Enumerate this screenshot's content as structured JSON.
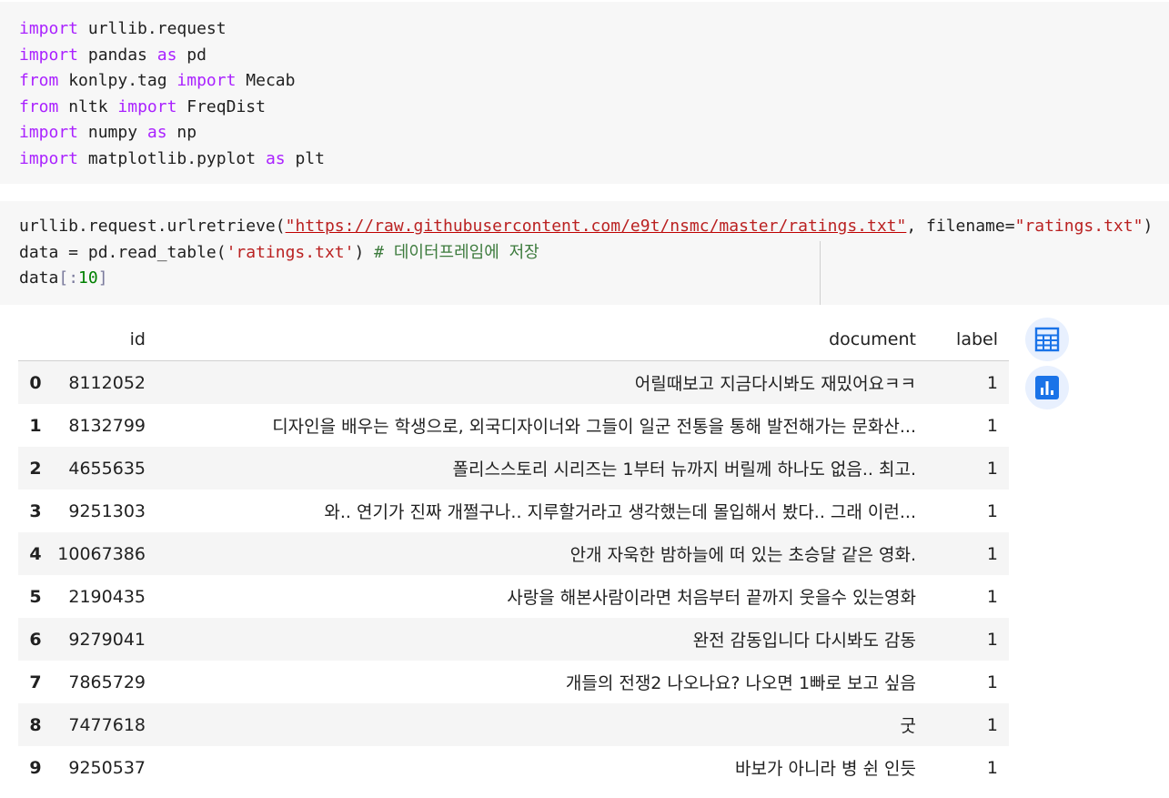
{
  "cell1": {
    "lines": [
      {
        "kw": "import",
        "rest": " urllib.request"
      },
      {
        "kw": "import",
        "mid": " pandas ",
        "kw2": "as",
        "rest": " pd"
      },
      {
        "kw": "from",
        "mid": " konlpy.tag ",
        "kw2": "import",
        "rest": " Mecab"
      },
      {
        "kw": "from",
        "mid": " nltk ",
        "kw2": "import",
        "rest": " FreqDist"
      },
      {
        "kw": "import",
        "mid": " numpy ",
        "kw2": "as",
        "rest": " np"
      },
      {
        "kw": "import",
        "mid": " matplotlib.pyplot ",
        "kw2": "as",
        "rest": " plt"
      }
    ]
  },
  "cell2": {
    "l1_a": "urllib.request.urlretrieve(",
    "l1_url": "\"https://raw.githubusercontent.com/e9t/nsmc/master/ratings.txt\"",
    "l1_b": ", filename=",
    "l1_fname": "\"ratings.txt\"",
    "l1_c": ")",
    "l2_a": "data = pd.read_table(",
    "l2_str": "'ratings.txt'",
    "l2_b": ") ",
    "l2_cmt": "# 데이터프레임에 저장",
    "l3_a": "data",
    "l3_b": "[:",
    "l3_num": "10",
    "l3_c": "]"
  },
  "table": {
    "columns": [
      "",
      "id",
      "document",
      "label"
    ],
    "rows": [
      {
        "idx": "0",
        "id": "8112052",
        "document": "어릴때보고 지금다시봐도 재밌어요ㅋㅋ",
        "label": "1"
      },
      {
        "idx": "1",
        "id": "8132799",
        "document": "디자인을 배우는 학생으로, 외국디자이너와 그들이 일군 전통을 통해 발전해가는 문화산...",
        "label": "1"
      },
      {
        "idx": "2",
        "id": "4655635",
        "document": "폴리스스토리 시리즈는 1부터 뉴까지 버릴께 하나도 없음.. 최고.",
        "label": "1"
      },
      {
        "idx": "3",
        "id": "9251303",
        "document": "와.. 연기가 진짜 개쩔구나.. 지루할거라고 생각했는데 몰입해서 봤다.. 그래 이런...",
        "label": "1"
      },
      {
        "idx": "4",
        "id": "10067386",
        "document": "안개 자욱한 밤하늘에 떠 있는 초승달 같은 영화.",
        "label": "1"
      },
      {
        "idx": "5",
        "id": "2190435",
        "document": "사랑을 해본사람이라면 처음부터 끝까지 웃을수 있는영화",
        "label": "1"
      },
      {
        "idx": "6",
        "id": "9279041",
        "document": "완전 감동입니다 다시봐도 감동",
        "label": "1"
      },
      {
        "idx": "7",
        "id": "7865729",
        "document": "개들의 전쟁2 나오나요? 나오면 1빠로 보고 싶음",
        "label": "1"
      },
      {
        "idx": "8",
        "id": "7477618",
        "document": "굿",
        "label": "1"
      },
      {
        "idx": "9",
        "id": "9250537",
        "document": "바보가 아니라 병 쉰 인듯",
        "label": "1"
      }
    ]
  },
  "side_buttons": [
    {
      "icon": "table-icon"
    },
    {
      "icon": "chart-icon"
    }
  ],
  "colors": {
    "keyword": "#aa22ff",
    "string": "#ba2121",
    "comment": "#3d7b3d",
    "accent": "#1a73e8"
  }
}
